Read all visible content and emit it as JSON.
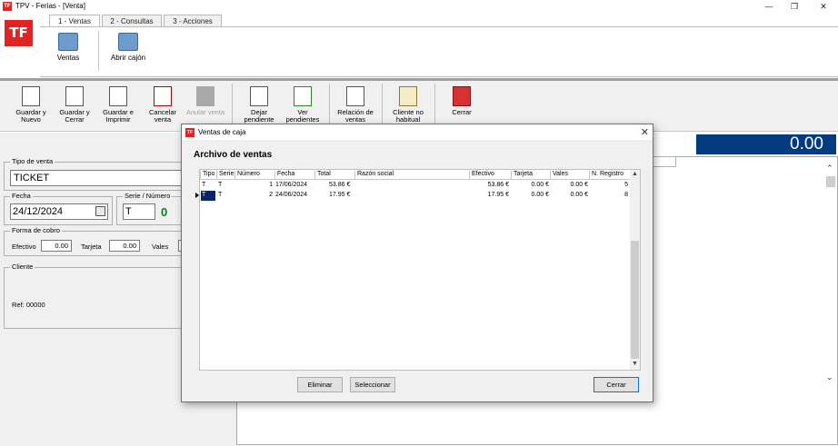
{
  "window": {
    "title": "TPV - Ferias - [Venta]",
    "app_badge": "TF",
    "minimize": "—",
    "restore": "❐",
    "close": "✕"
  },
  "ribbon": {
    "tabs": [
      {
        "label": "1 - Ventas"
      },
      {
        "label": "2 - Consultas"
      },
      {
        "label": "3 - Acciones"
      }
    ],
    "buttons": [
      {
        "label": "Ventas"
      },
      {
        "label": "Abrir cajón"
      }
    ]
  },
  "toolbar": {
    "buttons": [
      {
        "label1": "Guardar y",
        "label2": "Nuevo"
      },
      {
        "label1": "Guardar y",
        "label2": "Cerrar"
      },
      {
        "label1": "Guardar e",
        "label2": "Imprimir"
      },
      {
        "label1": "Cancelar",
        "label2": "venta"
      },
      {
        "label1": "Anular venta",
        "label2": ""
      },
      {
        "label1": "Dejar",
        "label2": "pendiente"
      },
      {
        "label1": "Ver",
        "label2": "pendientes"
      },
      {
        "label1": "Relación de",
        "label2": "ventas"
      },
      {
        "label1": "Cliente no",
        "label2": "habitual"
      },
      {
        "label1": "Cerrar",
        "label2": ""
      }
    ]
  },
  "total": "0.00",
  "form": {
    "tipo_venta_label": "Tipo de venta",
    "tipo_venta_value": "TICKET",
    "fecha_label": "Fecha",
    "fecha_value": "24/12/2024",
    "serie_label": "Serie / Número",
    "serie_value": "T",
    "numero_value": "0",
    "forma_cobro_label": "Forma de cobro",
    "efectivo_label": "Efectivo",
    "efectivo_value": "0.00",
    "tarjeta_label": "Tarjeta",
    "tarjeta_value": "0.00",
    "vales_label": "Vales",
    "cliente_label": "Cliente",
    "cliente_ref": "Ref: 00000"
  },
  "dialog": {
    "title": "Ventas de caja",
    "heading": "Archivo de ventas",
    "columns": [
      "Tipo",
      "Serie",
      "Número",
      "Fecha",
      "Total",
      "Razón social",
      "Efectivo",
      "Tarjeta",
      "Vales",
      "N. Registro"
    ],
    "rows": [
      {
        "tipo": "T",
        "serie": "T",
        "numero": "1",
        "fecha": "17/06/2024",
        "total": "53.86 €",
        "razon": "",
        "efectivo": "53.86 €",
        "tarjeta": "0.00 €",
        "vales": "0.00 €",
        "registro": "5"
      },
      {
        "tipo": "T",
        "serie": "T",
        "numero": "2",
        "fecha": "24/06/2024",
        "total": "17.95 €",
        "razon": "",
        "efectivo": "17.95 €",
        "tarjeta": "0.00 €",
        "vales": "0.00 €",
        "registro": "8"
      }
    ],
    "buttons": {
      "eliminar": "Eliminar",
      "seleccionar": "Seleccionar",
      "cerrar": "Cerrar"
    }
  }
}
